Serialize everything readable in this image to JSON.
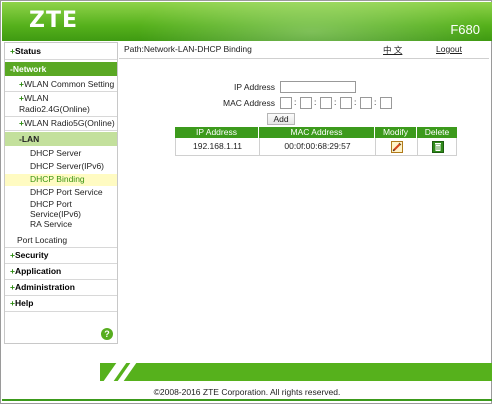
{
  "header": {
    "logo": "ZTE",
    "model": "F680"
  },
  "sidebar": {
    "status": "Status",
    "network": "-Network",
    "wlan_common": "WLAN Common Setting",
    "wlan_24_line1": "WLAN",
    "wlan_24_line2": "Radio2.4G(Online)",
    "wlan_5g": "WLAN Radio5G(Online)",
    "lan": "-LAN",
    "dhcp_server": "DHCP Server",
    "dhcp_server_v6": "DHCP Server(IPv6)",
    "dhcp_binding": "DHCP Binding",
    "dhcp_port_service": "DHCP Port Service",
    "dhcp_port_service_v6_line1": "DHCP Port",
    "dhcp_port_service_v6_line2": "Service(IPv6)",
    "ra_service": "RA Service",
    "port_locating": "Port Locating",
    "security": "Security",
    "application": "Application",
    "administration": "Administration",
    "help": "Help",
    "help_icon_glyph": "?"
  },
  "path": {
    "text": "Path:Network-LAN-DHCP Binding",
    "lang": "中 文",
    "logout": "Logout"
  },
  "form": {
    "ip_label": "IP Address",
    "ip_value": "",
    "mac_label": "MAC Address",
    "mac_values": [
      "",
      "",
      "",
      "",
      "",
      ""
    ],
    "mac_separator": ":",
    "add_label": "Add"
  },
  "table": {
    "headers": [
      "IP Address",
      "MAC Address",
      "Modify",
      "Delete"
    ],
    "rows": [
      {
        "ip": "192.168.1.11",
        "mac": "00:0f:00:68:29:57",
        "modify_icon": "edit-icon",
        "delete_icon": "trash-icon"
      }
    ]
  },
  "footer": {
    "copyright": "©2008-2016 ZTE Corporation. All rights reserved."
  },
  "colors": {
    "brand_green": "#56b11c",
    "table_header": "#3c9a1c",
    "lan_highlight": "#c3e09c",
    "selected_item": "#fffbc2"
  }
}
